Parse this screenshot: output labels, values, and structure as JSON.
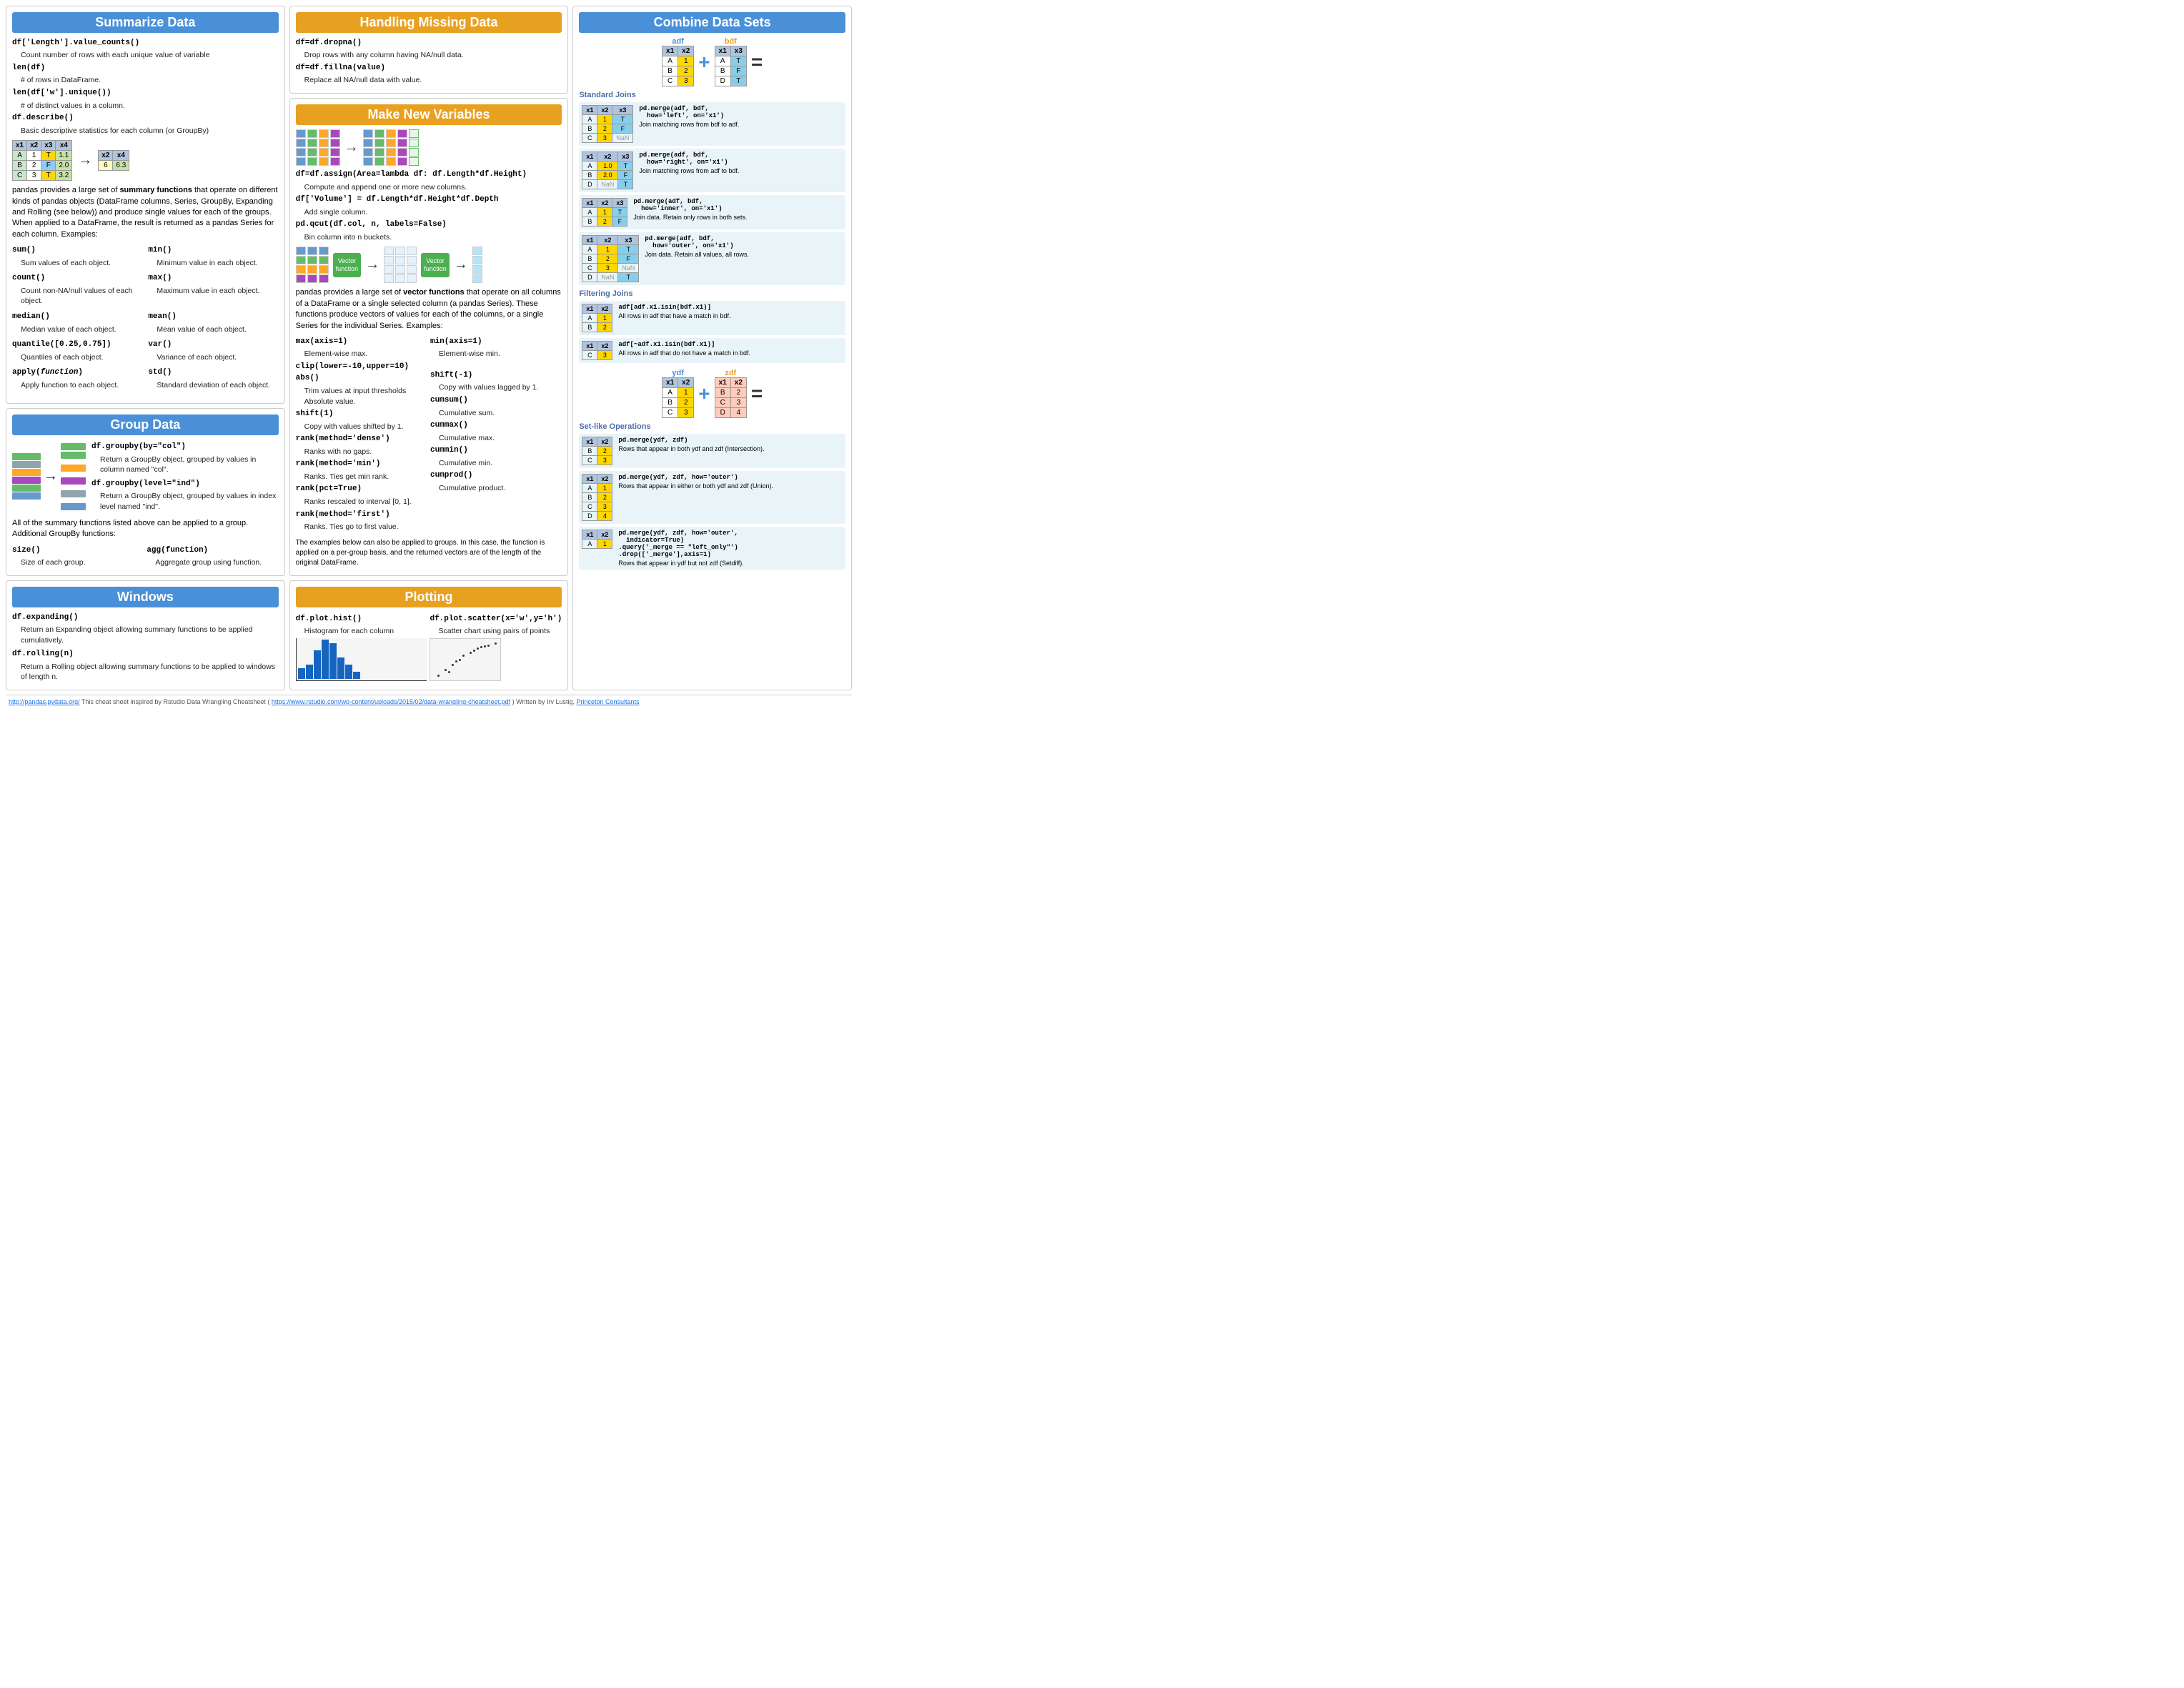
{
  "summarize": {
    "title": "Summarize Data",
    "code1": "df['Length'].value_counts()",
    "desc1": "Count number of rows with each unique value of variable",
    "code2": "len(df)",
    "desc2": "# of rows in DataFrame.",
    "code3": "len(df['w'].unique())",
    "desc3": "# of distinct values in a column.",
    "code4": "df.describe()",
    "desc4": "Basic descriptive statistics for each column (or GroupBy)",
    "para1": "pandas provides a large set of summary functions that operate on different kinds of pandas objects (DataFrame columns, Series, GroupBy, Expanding and Rolling (see below)) and produce single values for each of the groups. When applied to a DataFrame, the result is returned as a pandas Series for each column. Examples:",
    "functions": [
      {
        "name": "sum()",
        "desc": "Sum values of each object."
      },
      {
        "name": "min()",
        "desc": "Minimum value in each object."
      },
      {
        "name": "count()",
        "desc": "Count non-NA/null values of each object."
      },
      {
        "name": "max()",
        "desc": "Maximum value in each object."
      },
      {
        "name": "median()",
        "desc": "Median value of each object."
      },
      {
        "name": "mean()",
        "desc": "Mean value of each object."
      },
      {
        "name": "quantile([0.25,0.75])",
        "desc": "Quantiles of each object."
      },
      {
        "name": "var()",
        "desc": "Variance of each object."
      },
      {
        "name": "apply(function)",
        "desc": "Apply function to each object."
      },
      {
        "name": "std()",
        "desc": "Standard deviation of each object."
      }
    ]
  },
  "missing": {
    "title": "Handling Missing Data",
    "code1": "df=df.dropna()",
    "desc1": "Drop rows with any column having NA/null data.",
    "code2": "df=df.fillna(value)",
    "desc2": "Replace all NA/null data with value."
  },
  "newvar": {
    "title": "Make New Variables",
    "code1": "df=df.assign(Area=lambda df: df.Length*df.Height)",
    "desc1": "Compute and append one or more new columns.",
    "code2": "df['Volume'] = df.Length*df.Height*df.Depth",
    "desc2": "Add single column.",
    "code3": "pd.qcut(df.col, n, labels=False)",
    "desc3": "Bin column into n buckets.",
    "para1": "pandas provides a large set of vector functions that operate on all columns of a DataFrame or a single selected column (a pandas Series). These functions produce vectors of values for each of the columns, or a single Series for the individual Series. Examples:",
    "functions_left": [
      {
        "name": "max(axis=1)",
        "desc": "Element-wise max."
      },
      {
        "name": "clip(lower=-10,upper=10)",
        "desc": "Trim values at input thresholds"
      },
      {
        "name": "shift(1)",
        "desc": "Copy with values shifted by 1."
      },
      {
        "name": "rank(method='dense')",
        "desc": "Ranks with no gaps."
      },
      {
        "name": "rank(method='min')",
        "desc": "Ranks. Ties get min rank."
      },
      {
        "name": "rank(pct=True)",
        "desc": "Ranks rescaled to interval [0, 1]."
      },
      {
        "name": "rank(method='first')",
        "desc": "Ranks. Ties go to first value."
      }
    ],
    "functions_right": [
      {
        "name": "min(axis=1)",
        "desc": "Element-wise min."
      },
      {
        "name": "abs()",
        "desc": "Absolute value."
      },
      {
        "name": "shift(-1)",
        "desc": "Copy with values lagged by 1."
      },
      {
        "name": "cumsum()",
        "desc": "Cumulative sum."
      },
      {
        "name": "cummax()",
        "desc": "Cumulative max."
      },
      {
        "name": "cummin()",
        "desc": "Cumulative min."
      },
      {
        "name": "cumprod()",
        "desc": "Cumulative product."
      }
    ],
    "para2": "The examples below can also be applied to groups. In this case, the function is applied on a per-group basis, and the returned vectors are of the length of the original DataFrame."
  },
  "combine": {
    "title": "Combine Data Sets",
    "standard_joins_label": "Standard Joins",
    "filtering_joins_label": "Filtering Joins",
    "set_ops_label": "Set-like Operations",
    "joins": [
      {
        "code": "pd.merge(adf, bdf,\n  how='left', on='x1')",
        "desc": "Join matching rows from bdf to adf."
      },
      {
        "code": "pd.merge(adf, bdf,\n  how='right', on='x1')",
        "desc": "Join matching rows from adf to bdf."
      },
      {
        "code": "pd.merge(adf, bdf,\n  how='inner', on='x1')",
        "desc": "Join data. Retain only rows in both sets."
      },
      {
        "code": "pd.merge(adf, bdf,\n  how='outer', on='x1')",
        "desc": "Join data. Retain all values, all rows."
      }
    ],
    "filtering": [
      {
        "code": "adf[adf.x1.isin(bdf.x1)]",
        "desc": "All rows in adf that have a match in bdf."
      },
      {
        "code": "adf[~adf.x1.isin(bdf.x1)]",
        "desc": "All rows in adf that do not have a match in bdf."
      }
    ],
    "setops": [
      {
        "code": "pd.merge(ydf, zdf)",
        "desc": "Rows that appear in both ydf and zdf (Intersection)."
      },
      {
        "code": "pd.merge(ydf, zdf, how='outer')",
        "desc": "Rows that appear in either or both ydf and zdf (Union)."
      },
      {
        "code": "pd.merge(ydf, zdf, how='outer',\n  indicator=True)\n.query('_merge == \"left_only\"')\n.drop(['_merge'],axis=1)",
        "desc": "Rows that appear in ydf but not zdf (Setdiff)."
      }
    ]
  },
  "group": {
    "title": "Group Data",
    "code1": "df.groupby(by=\"col\")",
    "desc1": "Return a GroupBy object, grouped by values in column named \"col\".",
    "code2": "df.groupby(level=\"ind\")",
    "desc2": "Return a GroupBy object, grouped by values in index level named \"ind\".",
    "para1": "All of the summary functions listed above can be applied to a group. Additional GroupBy functions:",
    "code3": "size()",
    "desc3": "Size of each group.",
    "code4": "agg(function)",
    "desc4": "Aggregate group using function."
  },
  "windows": {
    "title": "Windows",
    "code1": "df.expanding()",
    "desc1": "Return an Expanding object allowing summary functions to be applied cumulatively.",
    "code2": "df.rolling(n)",
    "desc2": "Return a Rolling object allowing summary functions to be applied to windows of length n."
  },
  "plotting": {
    "title": "Plotting",
    "code1": "df.plot.hist()",
    "desc1": "Histogram for each column",
    "code2": "df.plot.scatter(x='w',y='h')",
    "desc2": "Scatter chart using pairs of points"
  },
  "footer": {
    "link1": "http://pandas.pydata.org/",
    "text1": "  This cheat sheet inspired by Rstudio Data Wrangling Cheatsheet (",
    "link2": "https://www.rstudio.com/wp-content/uploads/2015/02/data-wrangling-cheatsheet.pdf",
    "text2": ") Written by Irv Lustig,",
    "link3": "Princeton Consultants"
  }
}
